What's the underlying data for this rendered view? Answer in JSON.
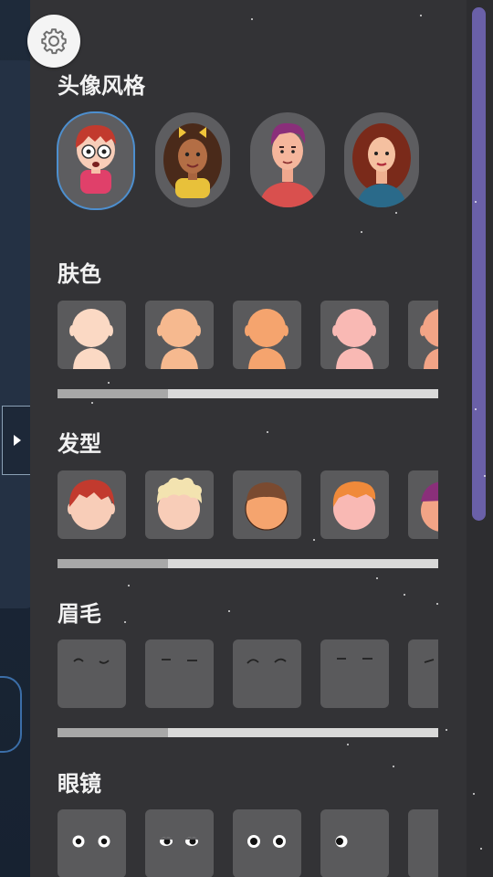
{
  "panel": {
    "settings_icon": "gear-icon",
    "expand_icon": "chevron-right-icon"
  },
  "sections": {
    "avatar_style": {
      "title": "头像风格",
      "selected_index": 0,
      "count": 4
    },
    "skin_color": {
      "title": "肤色",
      "swatches": [
        "#fbd9c4",
        "#f6b98f",
        "#f5a46e",
        "#f9b9b4",
        "#f2a486"
      ]
    },
    "hairstyle": {
      "title": "发型"
    },
    "eyebrows": {
      "title": "眉毛"
    },
    "glasses": {
      "title": "眼镜"
    }
  },
  "colors": {
    "panel_bg": "#333336",
    "tile_bg": "#5a5a5c",
    "accent": "#6a60a8",
    "selected_border": "#4d8fcf"
  }
}
